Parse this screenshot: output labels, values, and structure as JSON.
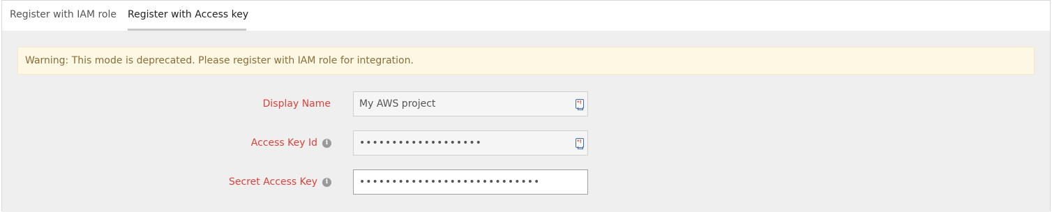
{
  "tabs": [
    {
      "label": "Register with IAM role",
      "active": false
    },
    {
      "label": "Register with Access key",
      "active": true
    }
  ],
  "warning": {
    "text": "Warning: This mode is deprecated. Please register with IAM role for integration."
  },
  "form": {
    "display_name": {
      "label": "Display Name",
      "value": "My AWS project"
    },
    "access_key_id": {
      "label": "Access Key Id",
      "masked_value": "•••••••••••••••••••"
    },
    "secret_access_key": {
      "label": "Secret Access Key",
      "masked_value": "••••••••••••••••••••••••••••"
    }
  },
  "icons": {
    "info": "info-icon",
    "password_manager": "password-manager-icon"
  },
  "colors": {
    "label_required": "#d9433c",
    "warning_bg": "#fcf8e3",
    "warning_text": "#8a6d3b",
    "content_bg": "#efefef"
  }
}
